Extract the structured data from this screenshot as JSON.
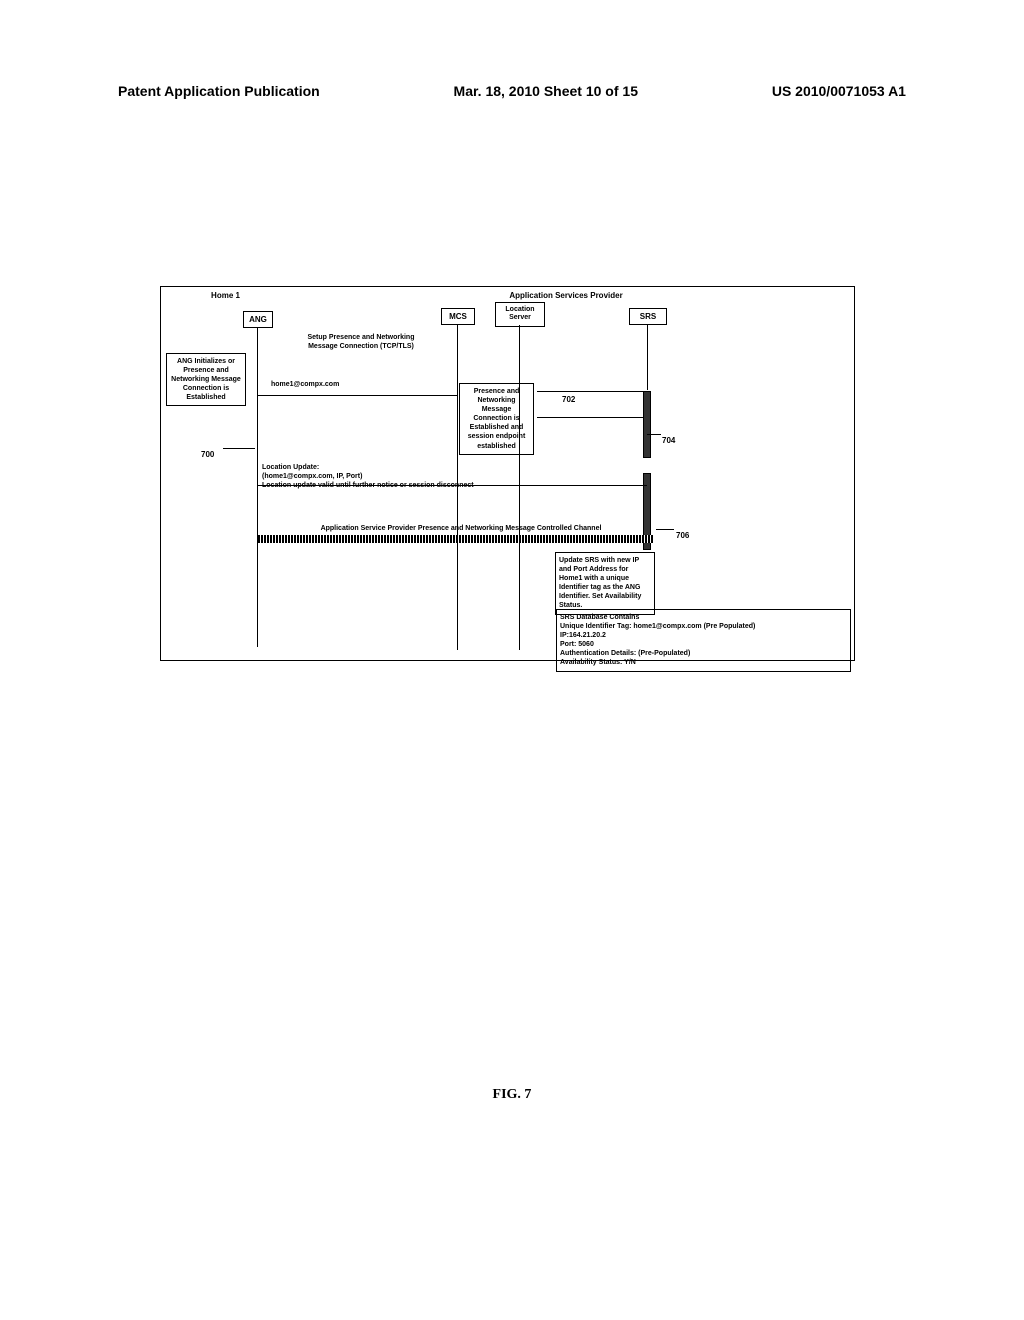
{
  "header": {
    "left": "Patent Application Publication",
    "center": "Mar. 18, 2010  Sheet 10 of 15",
    "right": "US 2010/0071053 A1"
  },
  "diagram": {
    "home_title": "Home 1",
    "asp_title": "Application Services Provider",
    "ang": "ANG",
    "mcs": "MCS",
    "ls": "Location Server",
    "srs": "SRS",
    "left_label": "ANG Initializes or Presence and Networking Message Connection is Established",
    "setup_label": "Setup Presence and Networking Message Connection (TCP/TLS)",
    "home_email": "home1@compx.com",
    "middle_label": "Presence and Networking Message Connection is Established and session endpoint established",
    "loc_update_title": "Location Update:",
    "loc_update_body": "(home1@compx.com, IP, Port)",
    "loc_update_note": "Location update valid until further notice or session disconnect",
    "channel_label": "Application Service Provider Presence and Networking Message Controlled Channel",
    "update_srs": "Update SRS with new IP and Port Address for Home1 with a unique Identifier tag as the ANG Identifier. Set Availability Status.",
    "srs_db_title": "SRS Database Contains",
    "srs_db_l1": "Unique Identifier Tag: home1@compx.com (Pre Populated)",
    "srs_db_l2": "IP:164.21.20.2",
    "srs_db_l3": "Port: 5060",
    "srs_db_l4": "Authentication Details: (Pre-Populated)",
    "srs_db_l5": "Availability Status: Y/N",
    "ref700": "700",
    "ref702": "702",
    "ref704": "704",
    "ref706": "706"
  },
  "figure_caption": "FIG. 7"
}
